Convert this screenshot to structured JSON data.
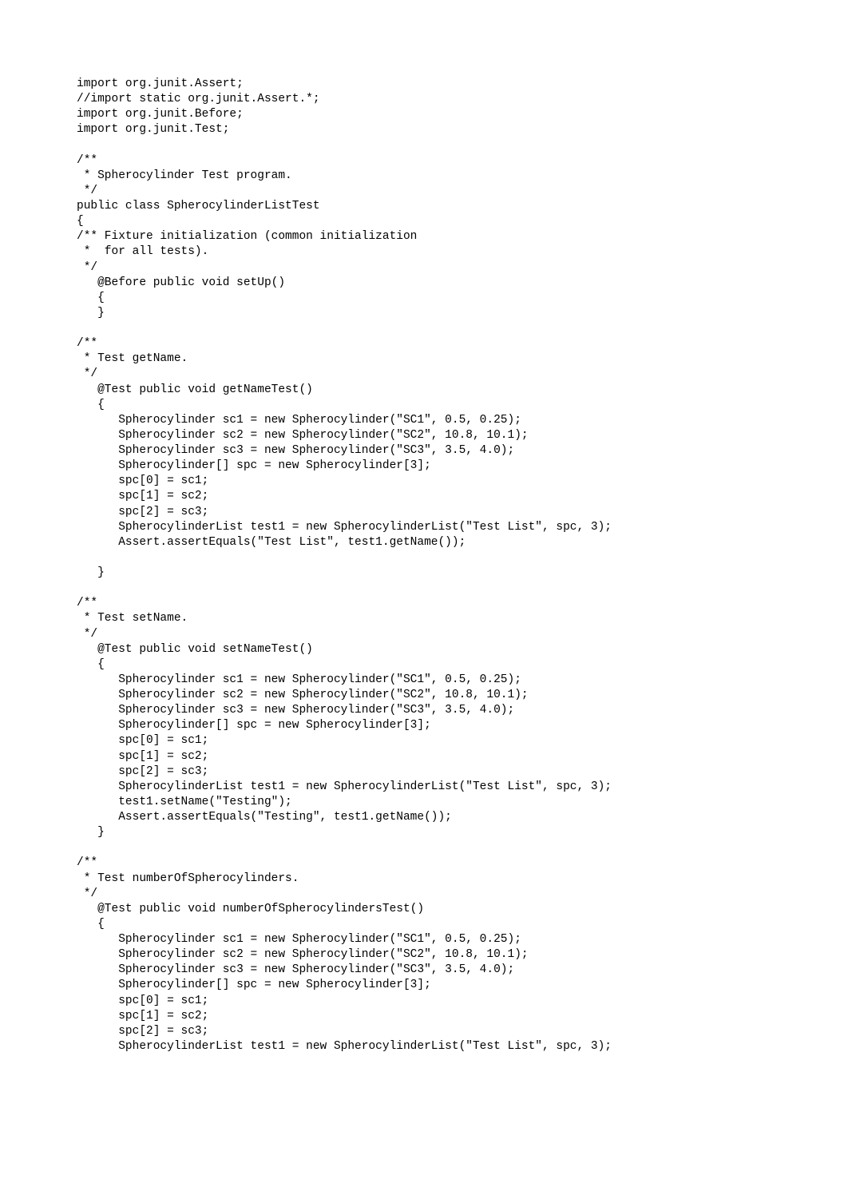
{
  "code": {
    "lines": [
      "import org.junit.Assert;",
      "//import static org.junit.Assert.*;",
      "import org.junit.Before;",
      "import org.junit.Test;",
      "",
      "/**",
      " * Spherocylinder Test program.",
      " */",
      "public class SpherocylinderListTest",
      "{",
      "/** Fixture initialization (common initialization",
      " *  for all tests).",
      " */",
      "   @Before public void setUp()",
      "   {",
      "   }",
      "",
      "/**",
      " * Test getName.",
      " */",
      "   @Test public void getNameTest()",
      "   {",
      "      Spherocylinder sc1 = new Spherocylinder(\"SC1\", 0.5, 0.25);",
      "      Spherocylinder sc2 = new Spherocylinder(\"SC2\", 10.8, 10.1);",
      "      Spherocylinder sc3 = new Spherocylinder(\"SC3\", 3.5, 4.0);",
      "      Spherocylinder[] spc = new Spherocylinder[3];",
      "      spc[0] = sc1;",
      "      spc[1] = sc2;",
      "      spc[2] = sc3;",
      "      SpherocylinderList test1 = new SpherocylinderList(\"Test List\", spc, 3);",
      "      Assert.assertEquals(\"Test List\", test1.getName());",
      "   ",
      "   }",
      "",
      "/**",
      " * Test setName.",
      " */ ",
      "   @Test public void setNameTest()",
      "   {",
      "      Spherocylinder sc1 = new Spherocylinder(\"SC1\", 0.5, 0.25);",
      "      Spherocylinder sc2 = new Spherocylinder(\"SC2\", 10.8, 10.1);",
      "      Spherocylinder sc3 = new Spherocylinder(\"SC3\", 3.5, 4.0);",
      "      Spherocylinder[] spc = new Spherocylinder[3];",
      "      spc[0] = sc1;",
      "      spc[1] = sc2;",
      "      spc[2] = sc3;",
      "      SpherocylinderList test1 = new SpherocylinderList(\"Test List\", spc, 3);",
      "      test1.setName(\"Testing\");",
      "      Assert.assertEquals(\"Testing\", test1.getName());",
      "   }",
      "",
      "/**",
      " * Test numberOfSpherocylinders.",
      " */ ",
      "   @Test public void numberOfSpherocylindersTest()",
      "   {",
      "      Spherocylinder sc1 = new Spherocylinder(\"SC1\", 0.5, 0.25);",
      "      Spherocylinder sc2 = new Spherocylinder(\"SC2\", 10.8, 10.1);",
      "      Spherocylinder sc3 = new Spherocylinder(\"SC3\", 3.5, 4.0);",
      "      Spherocylinder[] spc = new Spherocylinder[3];",
      "      spc[0] = sc1;",
      "      spc[1] = sc2;",
      "      spc[2] = sc3;",
      "      SpherocylinderList test1 = new SpherocylinderList(\"Test List\", spc, 3);"
    ]
  }
}
